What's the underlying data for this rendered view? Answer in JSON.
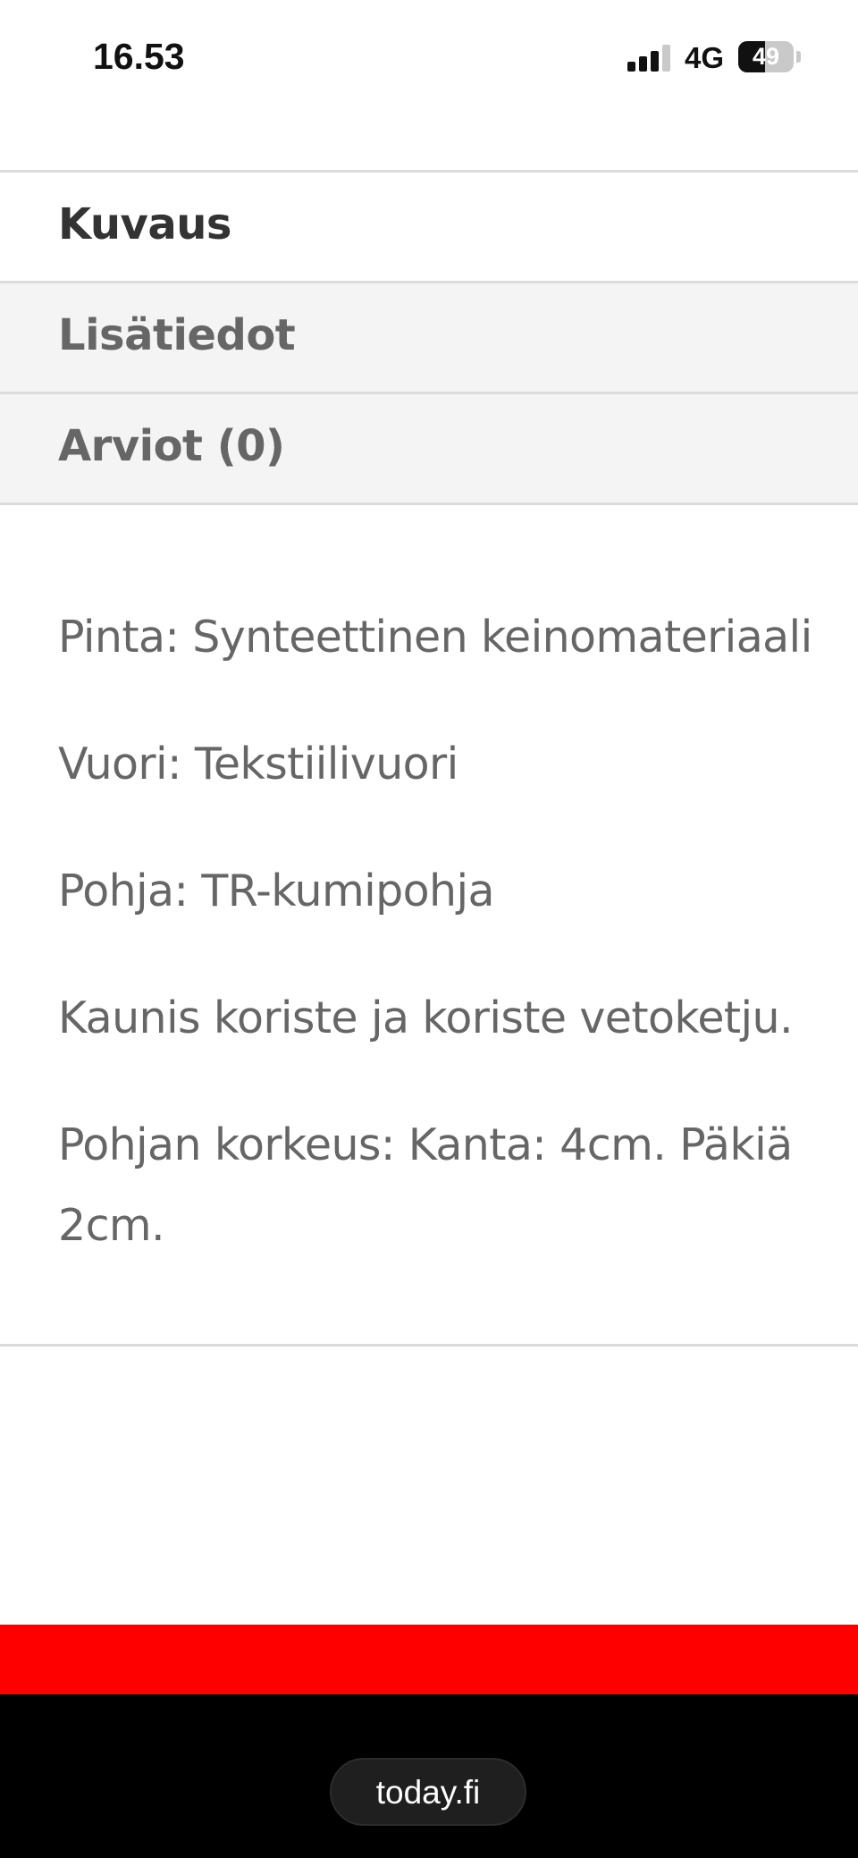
{
  "status_bar": {
    "time": "16.53",
    "network": "4G",
    "battery": "49",
    "battery_level": 0.49
  },
  "tabs": [
    {
      "label": "Kuvaus",
      "active": true
    },
    {
      "label": "Lisätiedot",
      "active": false
    },
    {
      "label": "Arviot (0)",
      "active": false
    }
  ],
  "description": {
    "lines": [
      "Pinta: Synteettinen keinomateriaali",
      "Vuori: Tekstiilivuori",
      "Pohja: TR-kumipohja",
      "Kaunis koriste ja koriste vetoketju.",
      "Pohjan korkeus: Kanta: 4cm. Päkiä 2cm."
    ]
  },
  "browser": {
    "url": "today.fi"
  },
  "colors": {
    "accent_red": "#ff0000",
    "footer_black": "#000000"
  },
  "icons": {
    "signal": "cellular-signal-icon",
    "battery": "battery-icon"
  }
}
